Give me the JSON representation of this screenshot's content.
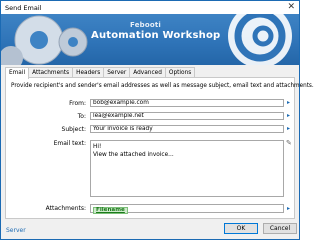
{
  "window": {
    "title": "Send Email",
    "close_glyph": "✕"
  },
  "banner": {
    "brand_small": "Febooti",
    "brand_big": "Automation Workshop"
  },
  "tabs": [
    "Email",
    "Attachments",
    "Headers",
    "Server",
    "Advanced",
    "Options"
  ],
  "description": "Provide recipient's and sender's email addresses as well as message subject, email text and attachments.",
  "form": {
    "from": {
      "label": "From:",
      "value": "bob@example.com"
    },
    "to": {
      "label": "To:",
      "value": "lea@example.net"
    },
    "subject": {
      "label": "Subject:",
      "value": "Your invoice is ready"
    },
    "email_text": {
      "label": "Email text:",
      "line1": "Hi!",
      "line2": "View the attached invoice..."
    },
    "attachments": {
      "label": "Attachments:",
      "chip": "Filename"
    }
  },
  "footer": {
    "link": "Server",
    "ok": "OK",
    "cancel": "Cancel"
  },
  "colors": {
    "accent": "#1b6ab3",
    "banner": "#2f74b8",
    "chip": "#cfeacc"
  }
}
